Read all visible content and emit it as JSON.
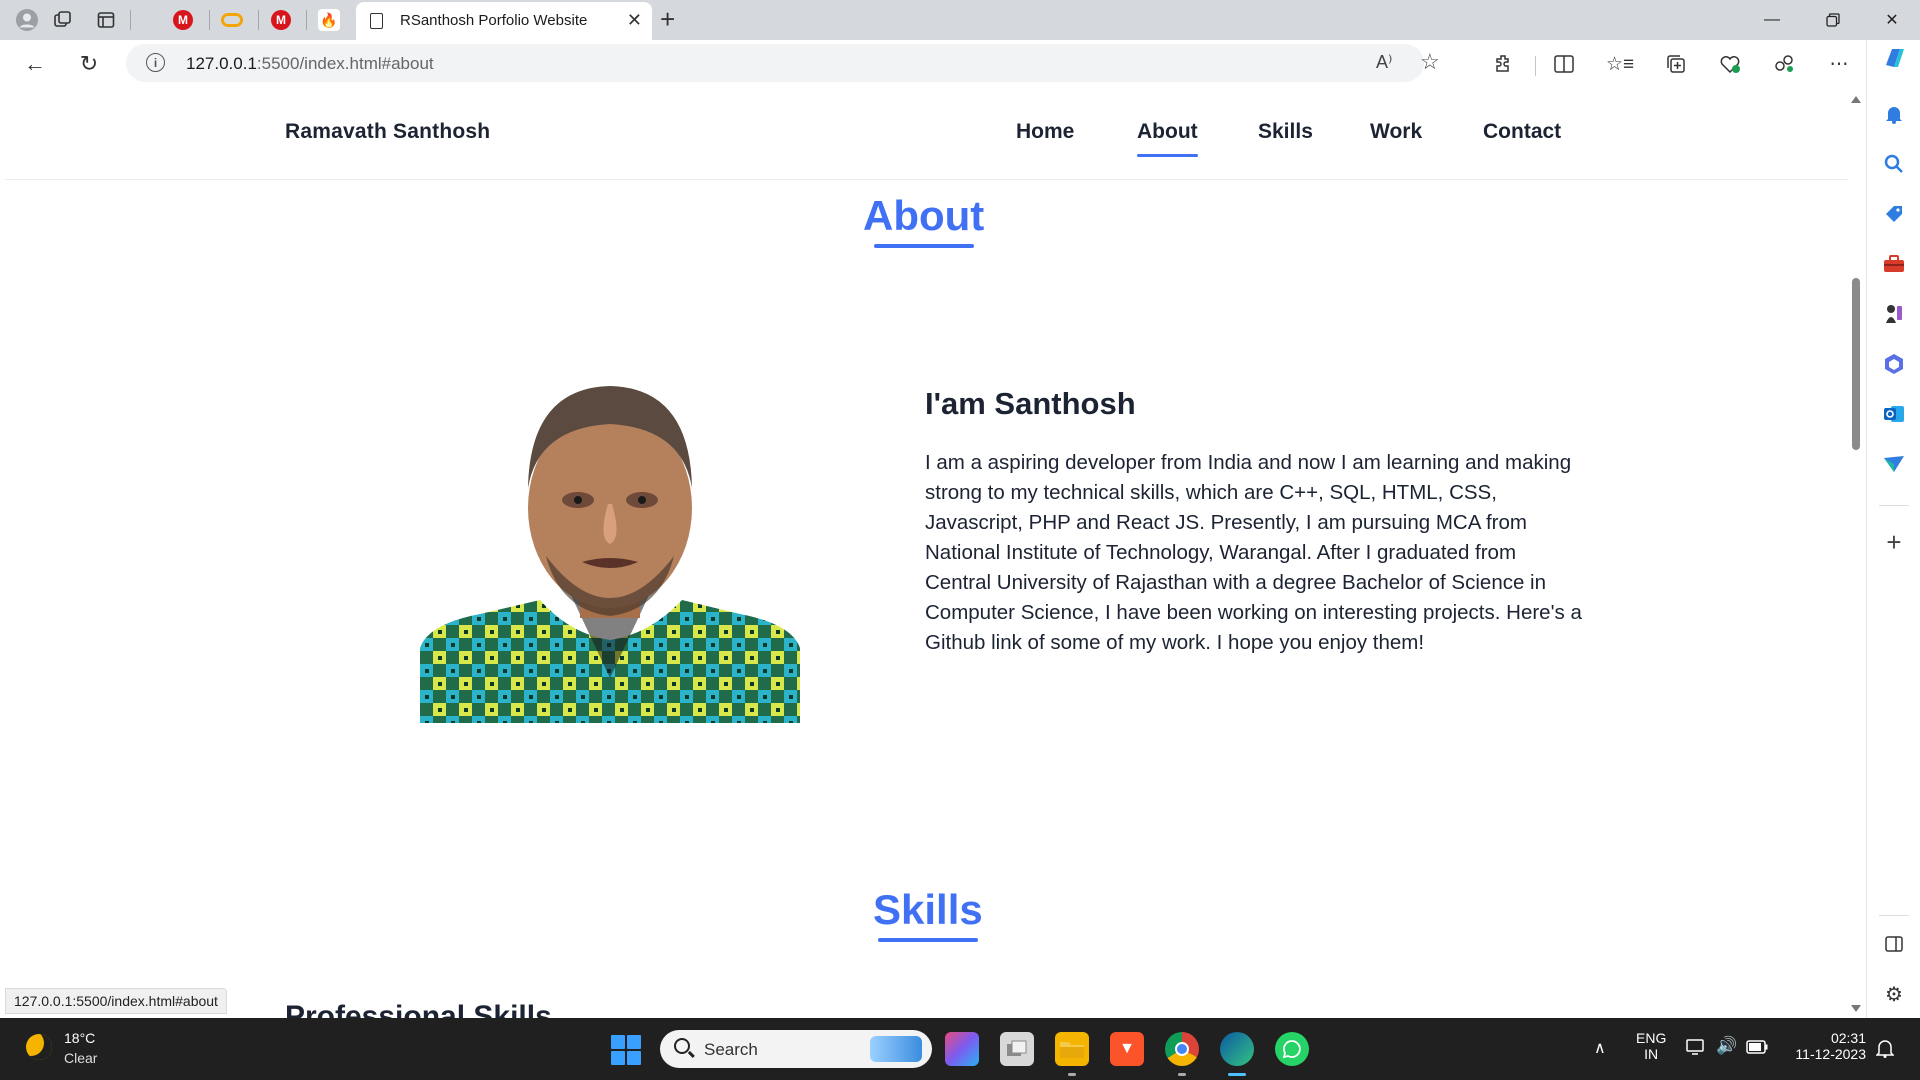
{
  "browser": {
    "active_tab_title": "RSanthosh Porfolio Website",
    "url_host": "127.0.0.1",
    "url_rest": ":5500/index.html#about",
    "status_link": "127.0.0.1:5500/index.html#about",
    "pinned_tabs": [
      "m-logo",
      "coursera-logo",
      "m-logo",
      "fire-logo"
    ]
  },
  "site": {
    "brand": "Ramavath Santhosh",
    "nav": [
      {
        "label": "Home"
      },
      {
        "label": "About"
      },
      {
        "label": "Skills"
      },
      {
        "label": "Work"
      },
      {
        "label": "Contact"
      }
    ],
    "active_nav": "About",
    "accent_color": "#4070f4"
  },
  "about": {
    "title": "About",
    "heading": "I'am Santhosh",
    "text": "I am a aspiring developer from India and now I am learning and making strong to my technical skills, which are C++, SQL, HTML, CSS, Javascript, PHP and React JS. Presently, I am pursuing MCA from National Institute of Technology, Warangal. After I graduated from Central University of Rajasthan with a degree Bachelor of Science in Computer Science, I have been working on interesting projects. Here's a Github link of some of my work. I hope you enjoy them!"
  },
  "skills": {
    "title": "Skills",
    "partial_heading": "Professional Skills"
  },
  "taskbar": {
    "weather_temp": "18°C",
    "weather_cond": "Clear",
    "search_label": "Search",
    "lang_1": "ENG",
    "lang_2": "IN",
    "time": "02:31",
    "date": "11-12-2023"
  }
}
